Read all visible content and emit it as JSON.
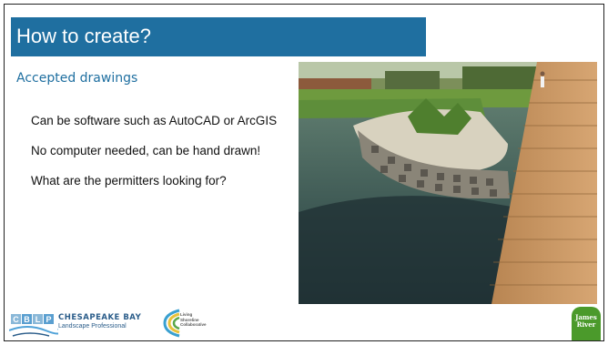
{
  "slide": {
    "title": "How to create?",
    "subtitle": "Accepted drawings",
    "bullets": [
      "Can be software such as AutoCAD or ArcGIS",
      "No computer needed, can be hand drawn!",
      "What are the permitters looking for?"
    ]
  },
  "colors": {
    "title_bar": "#1f6fa0",
    "subtitle": "#1f6fa0",
    "cblp_blue": "#2b5d8a",
    "james_river_green": "#4b9a2b"
  },
  "footer": {
    "cblp": {
      "letters": [
        "C",
        "B",
        "L",
        "P"
      ],
      "name": "CHESAPEAKE BAY",
      "sub": "Landscape Professional"
    },
    "living_shoreline": {
      "lines": [
        "Living",
        "Shoreline",
        "Collaborative"
      ]
    },
    "james_river": {
      "lines": [
        "James",
        "River"
      ]
    }
  },
  "photo": {
    "description_icon": "living-shoreline-photo"
  }
}
